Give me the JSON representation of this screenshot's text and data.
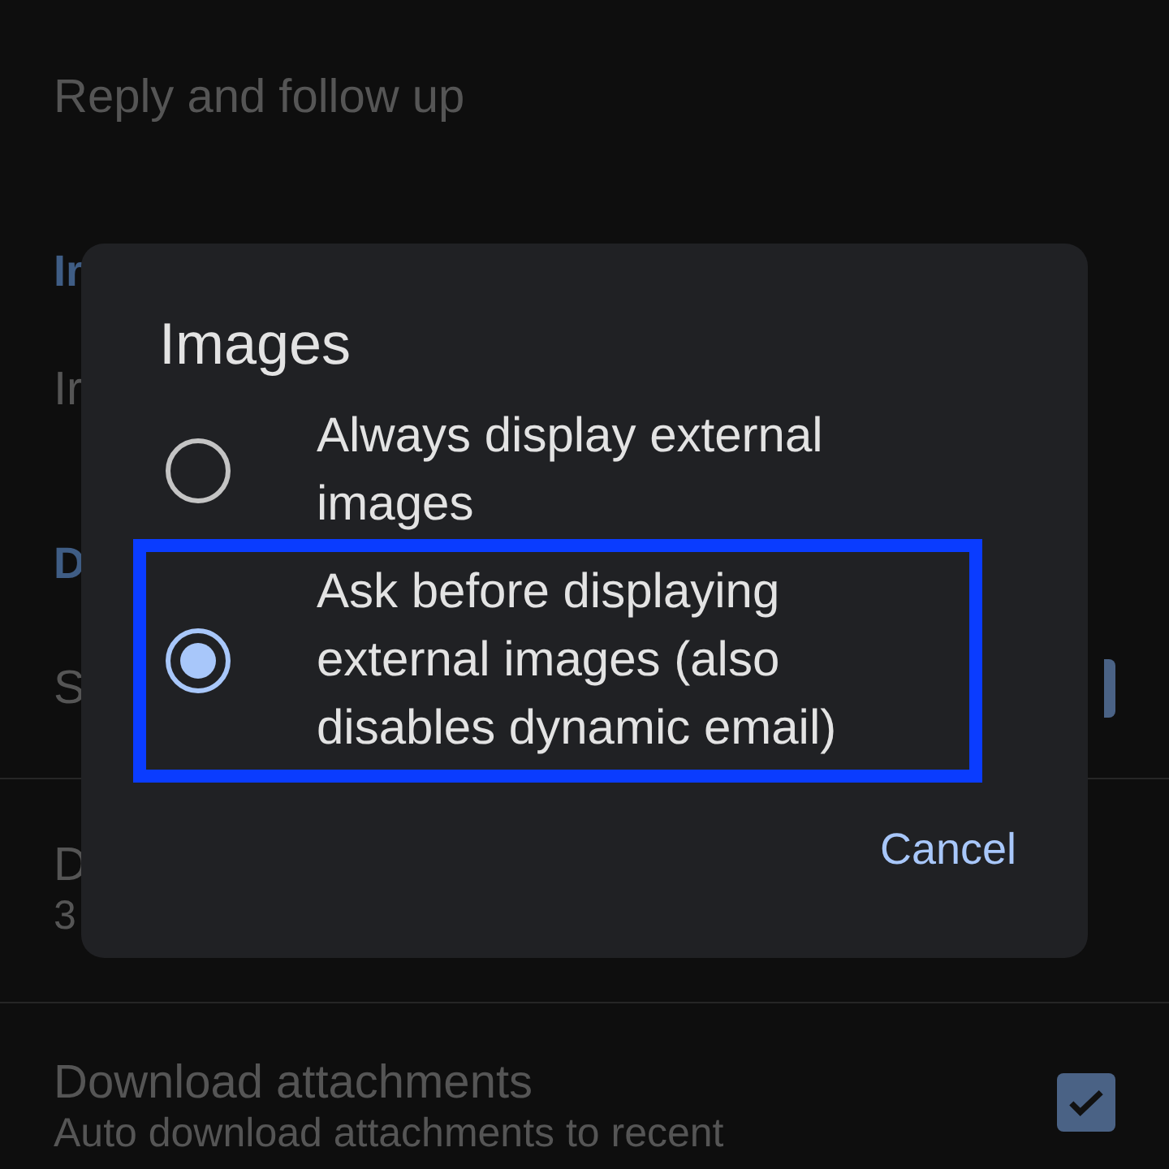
{
  "settings": [
    {
      "kind": "item",
      "title": "Reply and follow up"
    },
    {
      "kind": "header",
      "title": "Ir"
    },
    {
      "kind": "item",
      "title": "Ir"
    },
    {
      "kind": "header",
      "title": "D"
    },
    {
      "kind": "box",
      "title": "S"
    },
    {
      "kind": "item",
      "title": "D",
      "subtitle": "3"
    },
    {
      "kind": "check",
      "title": "Download attachments",
      "subtitle": "Auto download attachments to recent",
      "checked": true
    }
  ],
  "dialog": {
    "title": "Images",
    "options": [
      {
        "label": "Always display external images",
        "selected": false,
        "highlighted": false
      },
      {
        "label": "Ask before displaying external images (also disables dynamic email)",
        "selected": true,
        "highlighted": true
      }
    ],
    "button": "Cancel"
  }
}
